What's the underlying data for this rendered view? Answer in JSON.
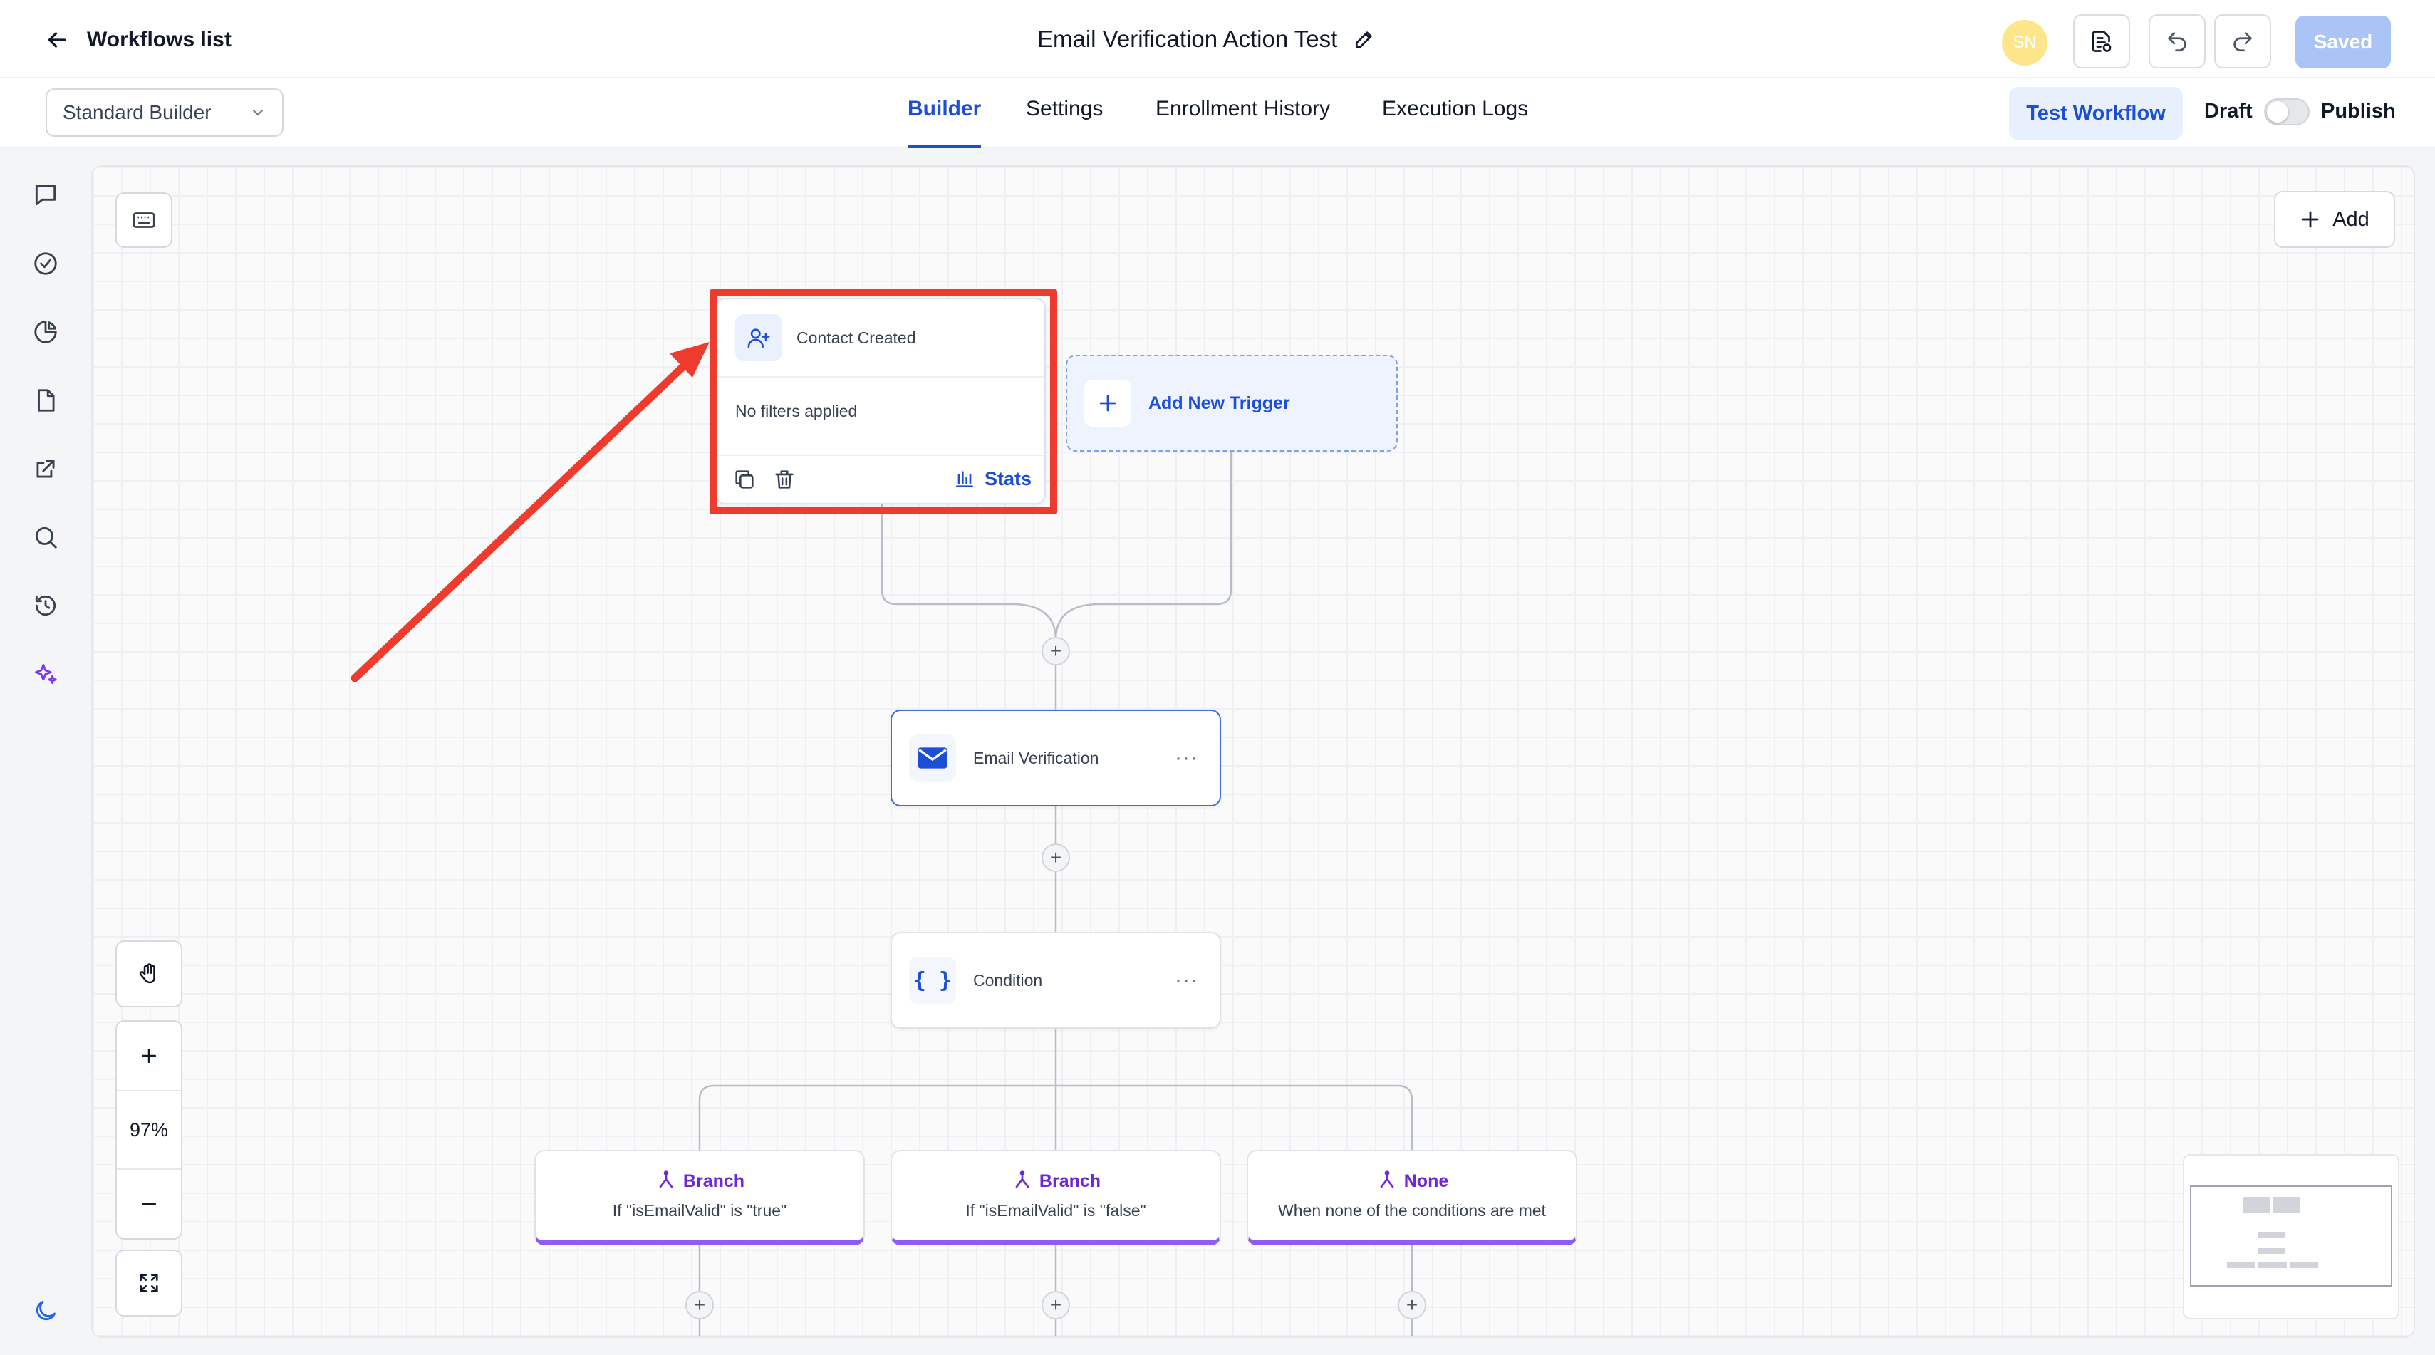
{
  "header": {
    "back_label": "Workflows list",
    "workflow_title": "Email Verification Action Test",
    "avatar_initials": "SN",
    "saved_label": "Saved"
  },
  "subheader": {
    "builder_select": "Standard Builder",
    "tabs": [
      {
        "label": "Builder",
        "active": true
      },
      {
        "label": "Settings",
        "active": false
      },
      {
        "label": "Enrollment History",
        "active": false
      },
      {
        "label": "Execution Logs",
        "active": false
      }
    ],
    "test_workflow_label": "Test Workflow",
    "draft_label": "Draft",
    "publish_label": "Publish",
    "publish_on": false
  },
  "rail": {
    "icons": [
      "chat-icon",
      "check-circle-icon",
      "pie-chart-icon",
      "file-icon",
      "external-link-icon",
      "search-icon",
      "history-icon",
      "sparkles-icon",
      "moon-icon"
    ]
  },
  "canvas": {
    "add_label": "Add",
    "zoom_label": "97%",
    "trigger": {
      "title": "Contact Created",
      "filters": "No filters applied",
      "stats_label": "Stats"
    },
    "add_trigger_label": "Add New Trigger",
    "actions": [
      {
        "label": "Email Verification",
        "icon": "envelope-icon"
      },
      {
        "label": "Condition",
        "icon": "braces-icon"
      }
    ],
    "branches": [
      {
        "title": "Branch",
        "subtitle": "If \"isEmailValid\" is \"true\""
      },
      {
        "title": "Branch",
        "subtitle": "If \"isEmailValid\" is \"false\""
      },
      {
        "title": "None",
        "subtitle": "When none of the conditions are met"
      }
    ]
  },
  "colors": {
    "accent": "#1d4ed8",
    "branch_accent": "#8b5cf6",
    "highlight": "#ef3b2d",
    "avatar": "#fde68a"
  }
}
